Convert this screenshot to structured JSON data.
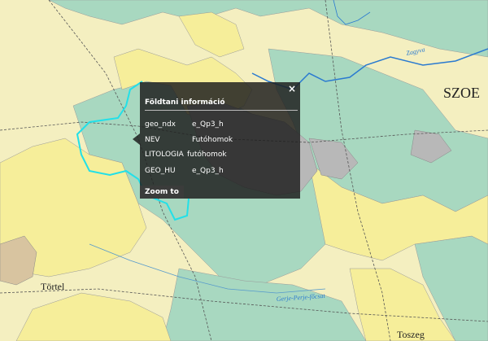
{
  "map": {
    "places": [
      "SZOE",
      "Törtel",
      "Toszeg"
    ],
    "stream_labels": [
      "Zagyva",
      "Gerje-Perje-főcsat"
    ]
  },
  "popup": {
    "title": "Földtani információ",
    "close_label": "×",
    "rows": [
      {
        "key": "geo_ndx",
        "value": "e_Qp3_h"
      },
      {
        "key": "NEV",
        "value": "Futóhomok"
      },
      {
        "key": "LITOLOGIA",
        "value": "futóhomok"
      },
      {
        "key": "GEO_HU",
        "value": "e_Qp3_h"
      }
    ],
    "zoom_label": "Zoom to"
  },
  "colors": {
    "sand_yellow": "#f6ee9a",
    "pale_cream": "#f4efc0",
    "sage_green": "#a8d8c0",
    "gray_loess": "#b8b8b8",
    "river_blue": "#2a7ad0",
    "selection_cyan": "#22e0e8",
    "tan": "#d8c4a0"
  }
}
